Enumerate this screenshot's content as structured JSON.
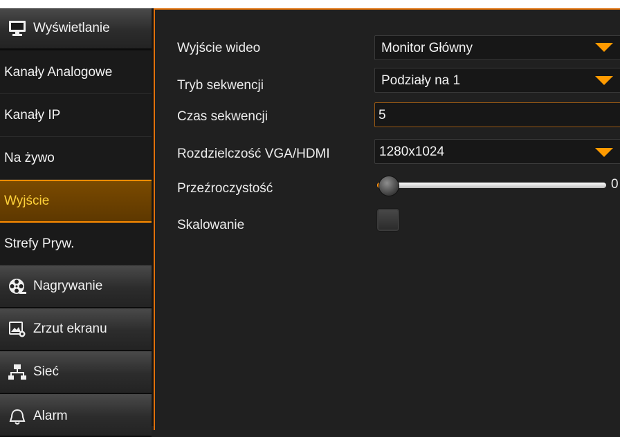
{
  "sidebar": {
    "items": [
      {
        "label": "Wyświetlanie",
        "icon": "monitor-icon"
      },
      {
        "label": "Kanały Analogowe"
      },
      {
        "label": "Kanały IP"
      },
      {
        "label": "Na żywo"
      },
      {
        "label": "Wyjście",
        "active": true
      },
      {
        "label": "Strefy Pryw."
      },
      {
        "label": "Nagrywanie",
        "icon": "film-reel-icon"
      },
      {
        "label": "Zrzut ekranu",
        "icon": "snapshot-icon"
      },
      {
        "label": "Sieć",
        "icon": "network-icon"
      },
      {
        "label": "Alarm",
        "icon": "alarm-bell-icon"
      }
    ]
  },
  "settings": {
    "video_output": {
      "label": "Wyjście wideo",
      "value": "Monitor Główny"
    },
    "sequence_mode": {
      "label": "Tryb sekwencji",
      "value": "Podziały na 1"
    },
    "sequence_time": {
      "label": "Czas sekwencji",
      "value": "5"
    },
    "resolution": {
      "label": "Rozdzielczość VGA/HDMI",
      "value": "1280x1024"
    },
    "transparency": {
      "label": "Przeźroczystość",
      "value": "0",
      "fraction": 0.0
    },
    "scaling": {
      "label": "Skalowanie",
      "checked": false
    }
  },
  "colors": {
    "accent": "#ff8c00",
    "active_text": "#ffd23a",
    "background": "#202020"
  }
}
